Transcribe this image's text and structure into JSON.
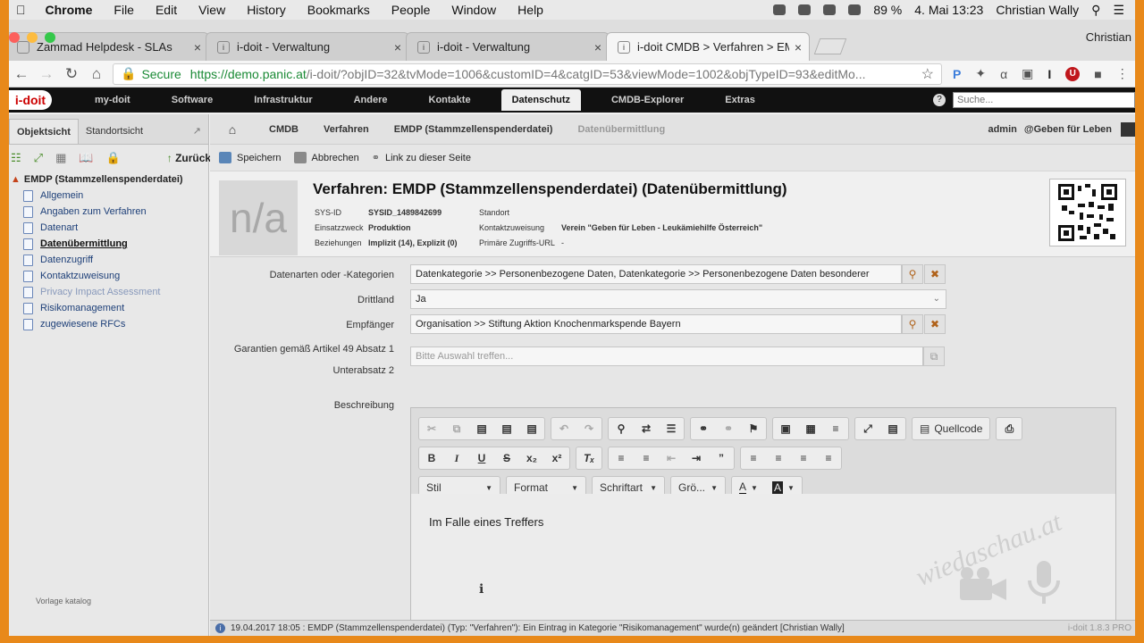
{
  "mac_menu": {
    "app": "Chrome",
    "items": [
      "File",
      "Edit",
      "View",
      "History",
      "Bookmarks",
      "People",
      "Window",
      "Help"
    ],
    "battery": "89 %",
    "datetime": "4. Mai  13:23",
    "user": "Christian Wally"
  },
  "browser": {
    "tabs": [
      {
        "title": "Zammad Helpdesk - SLAs",
        "active": false
      },
      {
        "title": "i-doit - Verwaltung",
        "active": false
      },
      {
        "title": "i-doit - Verwaltung",
        "active": false
      },
      {
        "title": "i-doit CMDB > Verfahren > EM",
        "active": true
      }
    ],
    "profile": "Christian",
    "secure_label": "Secure",
    "url_host": "https://demo.panic.at",
    "url_path": "/i-doit/?objID=32&tvMode=1006&customID=4&catgID=53&viewMode=1002&objTypeID=93&editMo..."
  },
  "app_nav": {
    "logo": "i-doit",
    "items": [
      "my-doit",
      "Software",
      "Infrastruktur",
      "Andere",
      "Kontakte",
      "Datenschutz",
      "CMDB-Explorer",
      "Extras"
    ],
    "active": "Datenschutz",
    "search_placeholder": "Suche..."
  },
  "left_panel": {
    "tab_object": "Objektsicht",
    "tab_location": "Standortsicht",
    "back_label": "Zurück",
    "root": "EMDP (Stammzellenspenderdatei)",
    "nodes": [
      {
        "label": "Allgemein",
        "state": "normal"
      },
      {
        "label": "Angaben zum Verfahren",
        "state": "normal"
      },
      {
        "label": "Datenart",
        "state": "normal"
      },
      {
        "label": "Datenübermittlung",
        "state": "current"
      },
      {
        "label": "Datenzugriff",
        "state": "normal"
      },
      {
        "label": "Kontaktzuweisung",
        "state": "normal"
      },
      {
        "label": "Privacy Impact Assessment",
        "state": "muted"
      },
      {
        "label": "Risikomanagement",
        "state": "normal"
      },
      {
        "label": "zugewiesene RFCs",
        "state": "normal"
      }
    ],
    "watermark": "Vorlage katalog"
  },
  "breadcrumb": {
    "items": [
      "CMDB",
      "Verfahren",
      "EMDP (Stammzellenspenderdatei)",
      "Datenübermittlung"
    ],
    "user": "admin",
    "tenant": "@Geben für Leben"
  },
  "actions": {
    "save": "Speichern",
    "cancel": "Abbrechen",
    "link": "Link zu dieser Seite"
  },
  "object_header": {
    "image_placeholder": "n/a",
    "title": "Verfahren: EMDP (Stammzellenspenderdatei) (Datenübermittlung)",
    "sys_id_label": "SYS-ID",
    "sys_id": "SYSID_1489842699",
    "purpose_label": "Einsatzzweck",
    "purpose": "Produktion",
    "relations_label": "Beziehungen",
    "relations": "Implizit (14), Explizit (0)",
    "location_label": "Standort",
    "location": "",
    "contact_label": "Kontaktzuweisung",
    "contact": "Verein \"Geben für Leben - Leukämiehilfe Österreich\"",
    "access_url_label": "Primäre Zugriffs-URL",
    "access_url": "-"
  },
  "form": {
    "datenarten_label": "Datenarten oder -Kategorien",
    "datenarten_value": "Datenkategorie >> Personenbezogene Daten, Datenkategorie >> Personenbezogene Daten besonderer",
    "drittland_label": "Drittland",
    "drittland_value": "Ja",
    "empfaenger_label": "Empfänger",
    "empfaenger_value": "Organisation >> Stiftung Aktion Knochenmarkspende Bayern",
    "garantien_label_1": "Garantien gemäß Artikel 49 Absatz 1",
    "garantien_label_2": "Unterabsatz 2",
    "garantien_placeholder": "Bitte Auswahl treffen...",
    "beschreibung_label": "Beschreibung"
  },
  "editor": {
    "source_label": "Quellcode",
    "style_label": "Stil",
    "format_label": "Format",
    "font_label": "Schriftart",
    "size_label": "Grö...",
    "content": "Im Falle eines Treffers"
  },
  "status_bar": {
    "message": "19.04.2017 18:05 : EMDP (Stammzellenspenderdatei) (Typ: \"Verfahren\"): Ein Eintrag in Kategorie \"Risikomanagement\" wurde(n) geändert [Christian Wally]",
    "version": "i-doit 1.8.3 PRO"
  },
  "watermark_text": "wiedaschau.at",
  "colors": {
    "frame": "#e8891a",
    "nav_bg": "#111111",
    "secure_green": "#1a8a35",
    "logo_red": "#cc0000"
  }
}
